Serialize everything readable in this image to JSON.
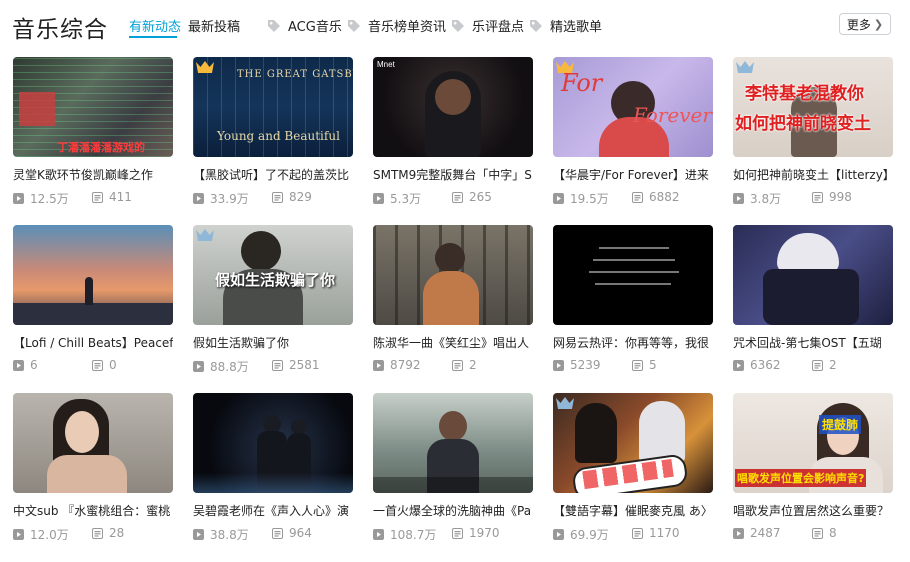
{
  "header": {
    "title": "音乐综合",
    "tabs": [
      {
        "label": "有新动态",
        "active": true
      },
      {
        "label": "最新投稿",
        "active": false
      }
    ],
    "tags": [
      "ACG音乐",
      "音乐榜单资讯",
      "乐评盘点",
      "精选歌单"
    ],
    "more_label": "更多"
  },
  "colors": {
    "accent": "#00a1d6",
    "muted": "#999999",
    "crown_gold": "#f6b93b",
    "crown_blue": "#8fb8d8"
  },
  "videos": [
    {
      "title": "灵堂K歌环节俊凯巅峰之作",
      "plays": "12.5万",
      "danmaku": "411",
      "crown": "none",
      "thumb_text": "丁潘潘潘潘游戏的"
    },
    {
      "title": "【黑胶试听】了不起的盖茨比",
      "plays": "33.9万",
      "danmaku": "829",
      "crown": "gold",
      "thumb_text": "THE GREAT GATSBY",
      "thumb_text2": "Young and Beautiful"
    },
    {
      "title": "SMTM9完整版舞台「中字」S",
      "plays": "5.3万",
      "danmaku": "265",
      "crown": "none",
      "thumb_text": "Mnet"
    },
    {
      "title": "【华晨宇/For Forever】进来",
      "plays": "19.5万",
      "danmaku": "6882",
      "crown": "gold",
      "thumb_text": "For",
      "thumb_text2": "Forever"
    },
    {
      "title": "如何把神前晓变土【litterzy】",
      "plays": "3.8万",
      "danmaku": "998",
      "crown": "blue",
      "thumb_text": "李特基老混教你",
      "thumb_text2": "如何把神前晓变土"
    },
    {
      "title": "【Lofi / Chill Beats】Peaceful",
      "plays": "6",
      "danmaku": "0",
      "crown": "none"
    },
    {
      "title": "假如生活欺骗了你",
      "plays": "88.8万",
      "danmaku": "2581",
      "crown": "blue",
      "thumb_text": "假如生活欺骗了你"
    },
    {
      "title": "陈淑华一曲《笑红尘》唱出人",
      "plays": "8792",
      "danmaku": "2",
      "crown": "none"
    },
    {
      "title": "网易云热评：你再等等，我很",
      "plays": "5239",
      "danmaku": "5",
      "crown": "none"
    },
    {
      "title": "咒术回战-第七集OST【五瑚",
      "plays": "6362",
      "danmaku": "2",
      "crown": "none"
    },
    {
      "title": "中文sub 『水蜜桃组合：蜜桃",
      "plays": "12.0万",
      "danmaku": "28",
      "crown": "none"
    },
    {
      "title": "吴碧霞老师在《声入人心》演",
      "plays": "38.8万",
      "danmaku": "964",
      "crown": "none"
    },
    {
      "title": "一首火爆全球的洗脑神曲《Pa",
      "plays": "108.7万",
      "danmaku": "1970",
      "crown": "none"
    },
    {
      "title": "【雙語字幕】催眠麥克風 あ〉",
      "plays": "69.9万",
      "danmaku": "1170",
      "crown": "blue"
    },
    {
      "title": "唱歌发声位置居然这么重要？",
      "plays": "2487",
      "danmaku": "8",
      "crown": "none",
      "thumb_text": "唱歌发声位置会影响声音?",
      "thumb_text2": "提鼓肺"
    }
  ]
}
